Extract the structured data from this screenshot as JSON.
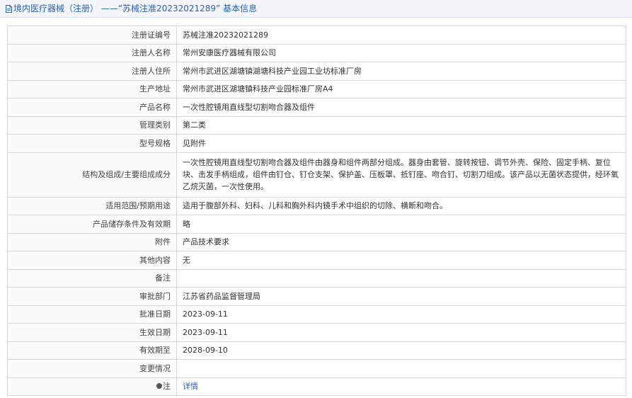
{
  "header": {
    "breadcrumb_label": "境内医疗器械（注册）",
    "separator": "——",
    "reg_no_quoted": "“苏械注准20232021289”",
    "suffix": "基本信息",
    "icon": "document-icon"
  },
  "rows": [
    {
      "label": "注册证编号",
      "value": "苏械注准20232021289"
    },
    {
      "label": "注册人名称",
      "value": "常州安康医疗器械有限公司"
    },
    {
      "label": "注册人住所",
      "value": "常州市武进区湖塘镇湖塘科技产业园工业坊标准厂房"
    },
    {
      "label": "生产地址",
      "value": "常州市武进区湖塘镇科技产业园标准厂房A4"
    },
    {
      "label": "产品名称",
      "value": "一次性腔镜用直线型切割吻合器及组件"
    },
    {
      "label": "管理类别",
      "value": "第二类"
    },
    {
      "label": "型号规格",
      "value": "见附件"
    },
    {
      "label": "结构及组成/主要组成成分",
      "value": "一次性腔镜用直线型切割吻合器及组件由器身和组件两部分组成。器身由套管、旋转按钮、调节外壳、保险、固定手柄、复位块、击发手柄组成，组件由钉仓、钉仓支架、保护盖、压板罩、抵钉座、吻合钉、切割刀组成。该产品以无菌状态提供，经环氧乙烷灭菌，一次性使用。"
    },
    {
      "label": "适用范围/预期用途",
      "value": "适用于腹部外科、妇科、儿科和胸外科内镜手术中组织的切除、横断和吻合。"
    },
    {
      "label": "产品储存条件及有效期",
      "value": "略"
    },
    {
      "label": "附件",
      "value": "产品技术要求"
    },
    {
      "label": "其他内容",
      "value": "无"
    },
    {
      "label": "备注",
      "value": ""
    },
    {
      "label": "审批部门",
      "value": "江苏省药品监督管理局"
    },
    {
      "label": "批准日期",
      "value": "2023-09-11"
    },
    {
      "label": "生效日期",
      "value": "2023-09-11"
    },
    {
      "label": "有效期至",
      "value": "2028-09-10"
    },
    {
      "label": "变更情况",
      "value": ""
    }
  ],
  "note_row": {
    "label": "注",
    "icon": "bulb-icon",
    "link_text": "详情"
  },
  "colors": {
    "accent": "#2b63b8",
    "border": "#d9d9d9",
    "header_bg": "#f3f5f8"
  }
}
